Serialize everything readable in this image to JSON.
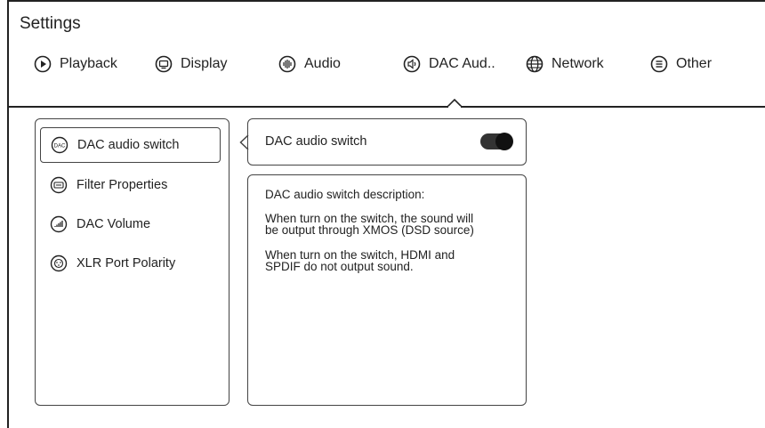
{
  "header": {
    "title": "Settings"
  },
  "tabs": [
    {
      "label": "Playback",
      "icon": "play-circle-icon"
    },
    {
      "label": "Display",
      "icon": "display-icon"
    },
    {
      "label": "Audio",
      "icon": "audio-wave-icon"
    },
    {
      "label": "DAC Aud..",
      "icon": "speaker-icon",
      "selected": true
    },
    {
      "label": "Network",
      "icon": "globe-icon"
    },
    {
      "label": "Other",
      "icon": "menu-circle-icon"
    }
  ],
  "sidebar": {
    "items": [
      {
        "label": "DAC audio switch",
        "icon": "dac-icon",
        "selected": true,
        "icon_text": "DAC"
      },
      {
        "label": "Filter Properties",
        "icon": "filter-icon"
      },
      {
        "label": "DAC Volume",
        "icon": "volume-icon"
      },
      {
        "label": "XLR Port Polarity",
        "icon": "xlr-port-icon"
      }
    ]
  },
  "setting": {
    "label": "DAC audio switch",
    "toggle_on": true
  },
  "description": {
    "title": "DAC audio switch description:",
    "para1_line1": "When turn on the switch, the sound will",
    "para1_line2": "be output through XMOS (DSD source)",
    "para2_line1": "When turn on the switch, HDMI and",
    "para2_line2": "SPDIF do not output sound."
  }
}
